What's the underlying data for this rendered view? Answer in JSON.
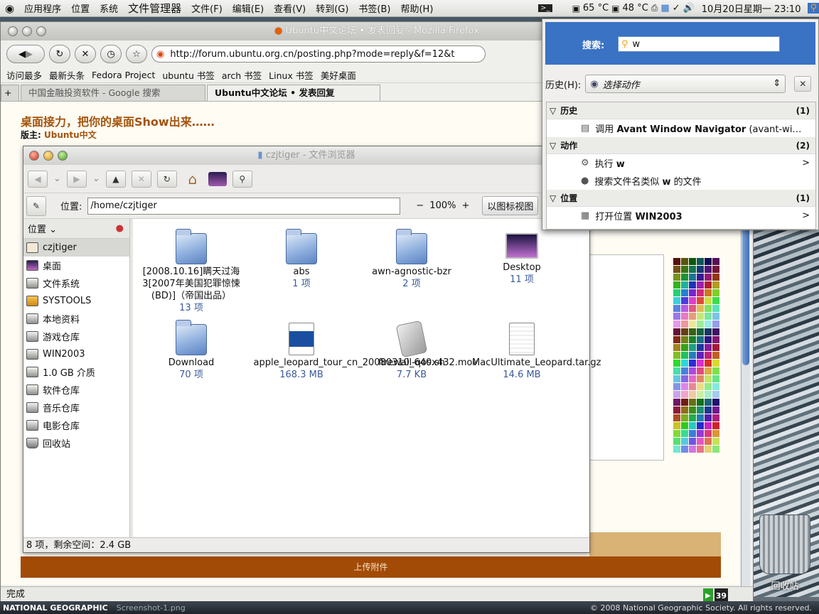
{
  "top_panel": {
    "menus": [
      "应用程序",
      "位置",
      "系统"
    ],
    "app_name": "文件管理器",
    "app_menus": [
      "文件(F)",
      "编辑(E)",
      "查看(V)",
      "转到(G)",
      "书签(B)",
      "帮助(H)"
    ],
    "temp1": "65 °C",
    "temp2": "48 °C",
    "clock": "10月20日星期一 23:10"
  },
  "firefox": {
    "title": "Ubuntu中文论坛 • 发表回复 - Mozilla Firefox",
    "url": "http://forum.ubuntu.org.cn/posting.php?mode=reply&f=12&t",
    "bookmarks": [
      "访问最多",
      "最新头条",
      "Fedora Project",
      "ubuntu 书签",
      "arch 书签",
      "Linux 书签",
      "美好桌面"
    ],
    "tabs": [
      "中国金融投资软件 - Google 搜索",
      "Ubuntu中文论坛 • 发表回复"
    ],
    "page_heading": "桌面接力，把你的桌面Show出来……",
    "moderator_label": "版主:",
    "moderator": "Ubuntu中文",
    "upload_label": "上传附件",
    "status": "完成",
    "badge": "39"
  },
  "nautilus": {
    "title": "czjtiger - 文件浏览器",
    "location_label": "位置:",
    "path": "/home/czjtiger",
    "zoom": "100%",
    "view_mode": "以图标视图",
    "side_header": "位置",
    "places": [
      "czjtiger",
      "桌面",
      "文件系统",
      "SYSTOOLS",
      "本地资料",
      "游戏仓库",
      "WIN2003",
      "1.0 GB 介质",
      "软件仓库",
      "音乐仓库",
      "电影仓库",
      "回收站"
    ],
    "files": [
      {
        "name": "[2008.10.16]瞒天过海3[2007年美国犯罪惊悚(BD)]（帝国出品）",
        "info": "13 项",
        "kind": "folder"
      },
      {
        "name": "abs",
        "info": "1 项",
        "kind": "folder"
      },
      {
        "name": "awn-agnostic-bzr",
        "info": "2 项",
        "kind": "folder"
      },
      {
        "name": "Desktop",
        "info": "11 项",
        "kind": "desktop"
      },
      {
        "name": "Download",
        "info": "70 项",
        "kind": "folder"
      },
      {
        "name": "apple_leopard_tour_cn_20080310_640x432.mov",
        "info": "168.3 MB",
        "kind": "video"
      },
      {
        "name": "firewall-qos.sh",
        "info": "7.7 KB",
        "kind": "script"
      },
      {
        "name": "MacUltimate_Leopard.tar.gz",
        "info": "14.6 MB",
        "kind": "tar"
      }
    ],
    "status": "8 项，剩余空间：2.4 GB"
  },
  "deskbar": {
    "search_label": "搜索:",
    "query": "w",
    "history_label": "历史(H):",
    "combo": "选择动作",
    "groups": [
      {
        "name": "历史",
        "count": "(1)",
        "rows": [
          {
            "pre": "调用 ",
            "bold": "Avant Window Navigator",
            "post": " (avant-wi…",
            "arrow": ""
          }
        ]
      },
      {
        "name": "动作",
        "count": "(2)",
        "rows": [
          {
            "pre": "执行 ",
            "bold": "w",
            "post": "",
            "arrow": ">"
          },
          {
            "pre": "搜索文件名类似 ",
            "bold": "w",
            "post": " 的文件",
            "arrow": ""
          }
        ]
      },
      {
        "name": "位置",
        "count": "(1)",
        "rows": [
          {
            "pre": "打开位置 ",
            "bold": "WIN2003",
            "post": "",
            "arrow": ">"
          }
        ]
      }
    ]
  },
  "desktop": {
    "trash_label": "回收站",
    "footer_left": "NATIONAL GEOGRAPHIC",
    "footer_file": "Screenshot-1.png",
    "footer_right": "© 2008 National Geographic Society. All rights reserved."
  },
  "colors": {
    "accent": "#3a72c4",
    "brand_orange": "#a5530b",
    "upload_bar": "#a24b07"
  }
}
